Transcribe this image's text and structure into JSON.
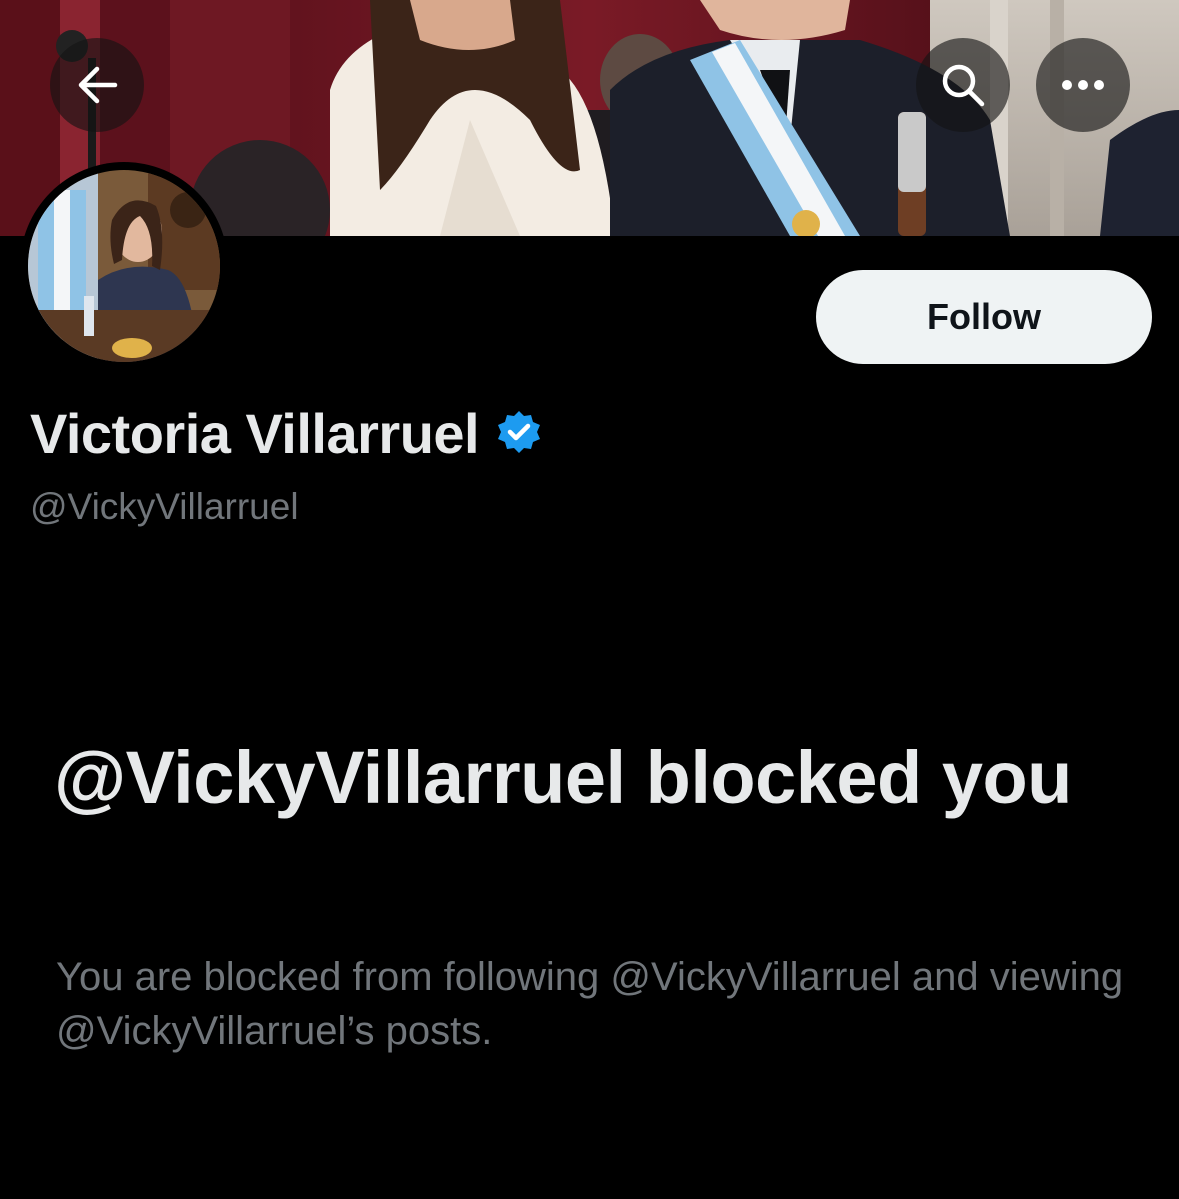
{
  "header": {
    "back_icon": "arrow-left-icon",
    "search_icon": "search-icon",
    "more_icon": "more-horizontal-icon"
  },
  "profile": {
    "display_name": "Victoria Villarruel",
    "verified_icon": "verified-badge-icon",
    "verified_color": "#1d9bf0",
    "handle": "@VickyVillarruel"
  },
  "actions": {
    "follow_label": "Follow"
  },
  "blocked": {
    "title": "@VickyVillarruel blocked you",
    "description": "You are blocked from following @VickyVillarruel and viewing @VickyVillarruel’s posts."
  },
  "colors": {
    "background": "#000000",
    "primary_text": "#e7e9ea",
    "secondary_text": "#71767b",
    "follow_bg": "#eff3f4",
    "follow_text": "#0f1419"
  }
}
